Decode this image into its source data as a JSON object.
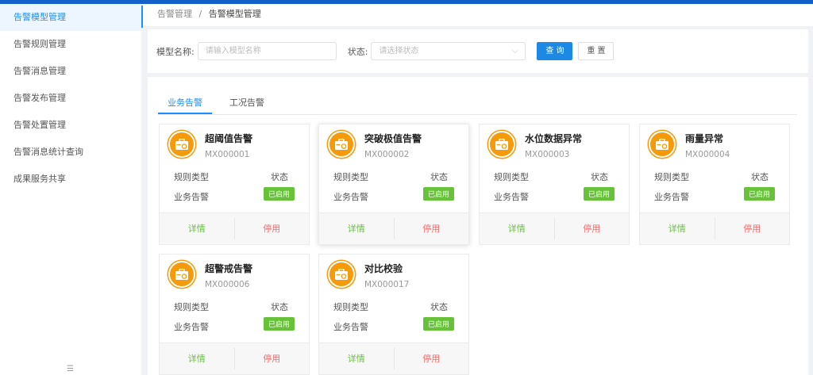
{
  "sidebar": {
    "items": [
      "告警模型管理",
      "告警规则管理",
      "告警消息管理",
      "告警发布管理",
      "告警处置管理",
      "告警消息统计查询",
      "成果服务共享"
    ]
  },
  "breadcrumb": {
    "parent": "告警管理",
    "sep": "/",
    "current": "告警模型管理"
  },
  "filter": {
    "name_label": "模型名称:",
    "name_placeholder": "请输入模型名称",
    "status_label": "状态:",
    "status_placeholder": "请选择状态",
    "query": "查 询",
    "reset": "重 置"
  },
  "tabs": [
    "业务告警",
    "工况告警"
  ],
  "card_labels": {
    "rule_type": "规则类型",
    "status": "状态",
    "detail": "详情",
    "disable": "停用"
  },
  "cards": [
    {
      "title": "超阈值告警",
      "code": "MX000001",
      "type": "业务告警",
      "status": "已启用"
    },
    {
      "title": "突破极值告警",
      "code": "MX000002",
      "type": "业务告警",
      "status": "已启用"
    },
    {
      "title": "水位数据异常",
      "code": "MX000003",
      "type": "业务告警",
      "status": "已启用"
    },
    {
      "title": "雨量异常",
      "code": "MX000004",
      "type": "业务告警",
      "status": "已启用"
    },
    {
      "title": "超警戒告警",
      "code": "MX000006",
      "type": "业务告警",
      "status": "已启用"
    },
    {
      "title": "对比校验",
      "code": "MX000017",
      "type": "业务告警",
      "status": "已启用"
    }
  ],
  "colors": {
    "accent": "#1890ff",
    "icon": "#f59a0b",
    "success": "#67c23a",
    "danger": "#f56c6c"
  }
}
